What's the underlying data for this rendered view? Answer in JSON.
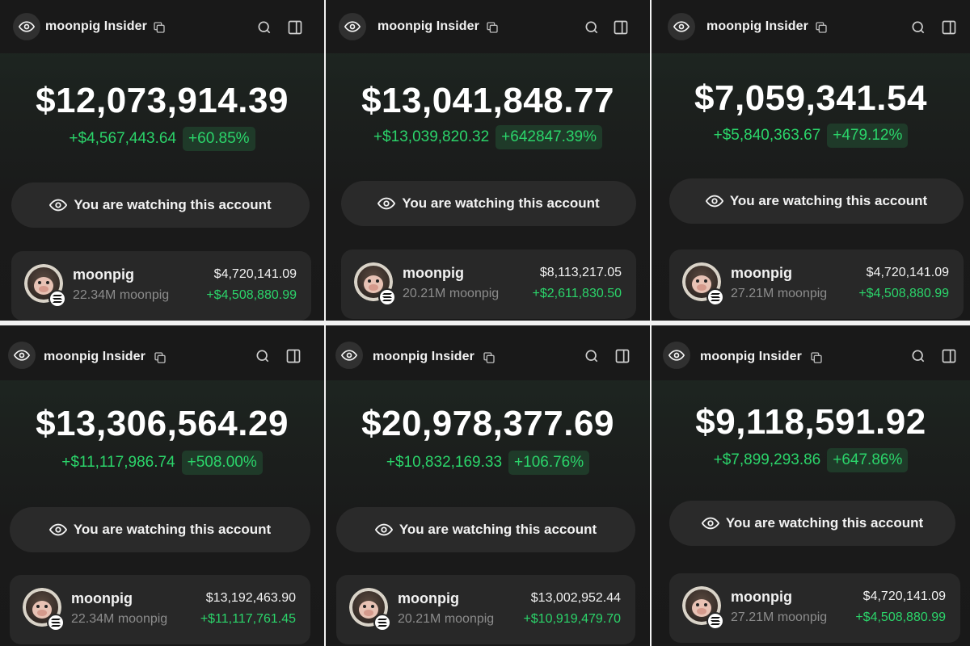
{
  "app": {
    "title": "moonpig Insider",
    "watch_label": "You are watching this account"
  },
  "colors": {
    "positive": "#2bd46a",
    "positive_bg": "#1f3a29",
    "panel_bg": "#191919",
    "card_bg": "#282828"
  },
  "icons": [
    "eye-icon",
    "copy-icon",
    "search-icon",
    "side-panel-icon",
    "solana-icon"
  ],
  "panels": [
    {
      "balance": "$12,073,914.39",
      "pnl_amount": "+$4,567,443.64",
      "pnl_percent": "+60.85%",
      "token": {
        "name": "moonpig",
        "amount": "22.34M moonpig",
        "value": "$4,720,141.09",
        "change": "+$4,508,880.99"
      }
    },
    {
      "balance": "$13,041,848.77",
      "pnl_amount": "+$13,039,820.32",
      "pnl_percent": "+642847.39%",
      "token": {
        "name": "moonpig",
        "amount": "20.21M moonpig",
        "value": "$8,113,217.05",
        "change": "+$2,611,830.50"
      }
    },
    {
      "balance": "$7,059,341.54",
      "pnl_amount": "+$5,840,363.67",
      "pnl_percent": "+479.12%",
      "token": {
        "name": "moonpig",
        "amount": "27.21M moonpig",
        "value": "$4,720,141.09",
        "change": "+$4,508,880.99"
      }
    },
    {
      "balance": "$13,306,564.29",
      "pnl_amount": "+$11,117,986.74",
      "pnl_percent": "+508.00%",
      "token": {
        "name": "moonpig",
        "amount": "22.34M moonpig",
        "value": "$13,192,463.90",
        "change": "+$11,117,761.45"
      }
    },
    {
      "balance": "$20,978,377.69",
      "pnl_amount": "+$10,832,169.33",
      "pnl_percent": "+106.76%",
      "token": {
        "name": "moonpig",
        "amount": "20.21M moonpig",
        "value": "$13,002,952.44",
        "change": "+$10,919,479.70"
      }
    },
    {
      "balance": "$9,118,591.92",
      "pnl_amount": "+$7,899,293.86",
      "pnl_percent": "+647.86%",
      "token": {
        "name": "moonpig",
        "amount": "27.21M moonpig",
        "value": "$4,720,141.09",
        "change": "+$4,508,880.99"
      }
    }
  ]
}
